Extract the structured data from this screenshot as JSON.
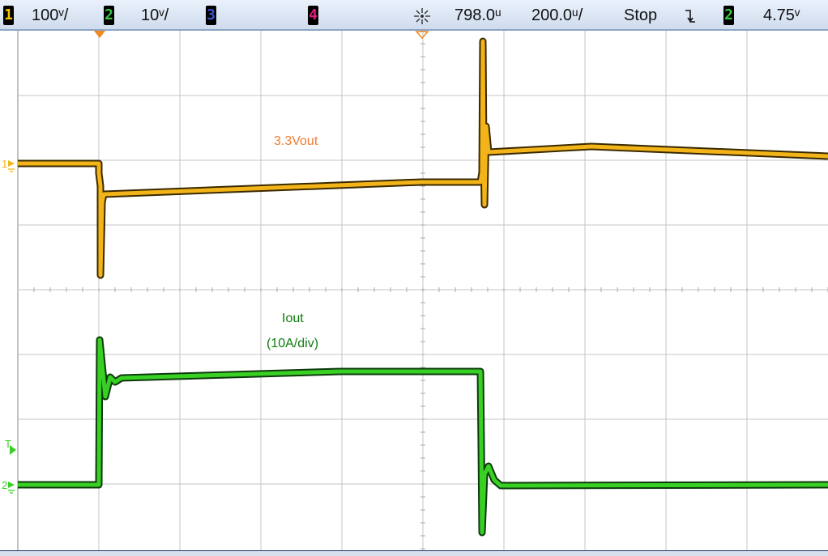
{
  "header": {
    "ch1": {
      "num": "1",
      "scale": "100ᵛ/",
      "color": "#f4c400"
    },
    "ch2": {
      "num": "2",
      "scale": "10ᵛ/",
      "color": "#3cc83c"
    },
    "ch3": {
      "num": "3",
      "color": "#3a55c8"
    },
    "ch4": {
      "num": "4",
      "color": "#e0207a"
    },
    "trigger_icon": "burst-icon",
    "delay": "798.0ᵘ",
    "timebase": "200.0ᵘ/",
    "run_state": "Stop",
    "trigger_edge": "falling-edge-icon",
    "trigger_source": "2",
    "trigger_level": "4.75ᵛ"
  },
  "annotations": {
    "ch1_label": "3.3Vout",
    "ch2_label": "Iout",
    "ch2_scale": "(10A/div)"
  },
  "markers": {
    "ch1_ground": "1",
    "ch2_ground": "2",
    "trigger_level": "T"
  },
  "colors": {
    "ch1_trace": "#f2b418",
    "ch1_text": "#f07a30",
    "ch2_trace": "#39d024",
    "ch2_text": "#0d7a0d",
    "grid": "#c4c4c4"
  }
}
